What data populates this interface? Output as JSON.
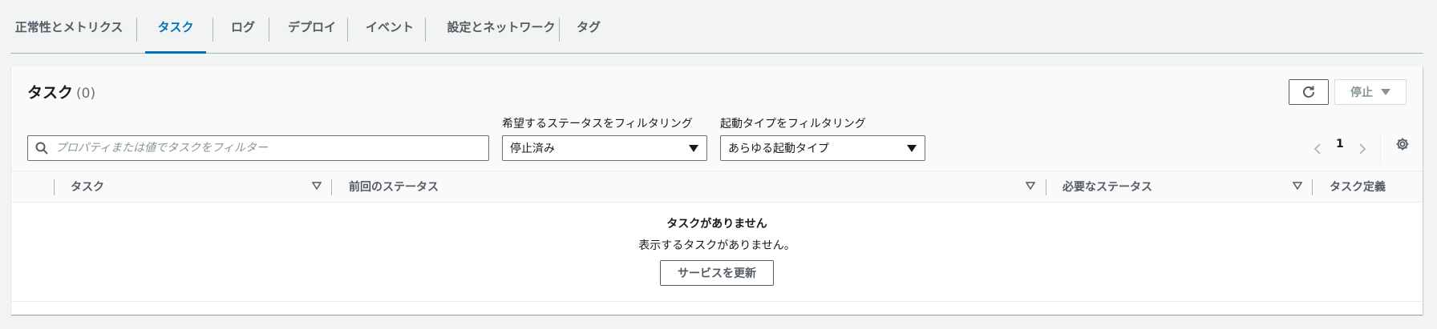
{
  "tabs": [
    {
      "label": "正常性とメトリクス",
      "active": false
    },
    {
      "label": "タスク",
      "active": true
    },
    {
      "label": "ログ",
      "active": false
    },
    {
      "label": "デプロイ",
      "active": false
    },
    {
      "label": "イベント",
      "active": false
    },
    {
      "label": "設定とネットワーク",
      "active": false
    },
    {
      "label": "タグ",
      "active": false
    }
  ],
  "panel": {
    "title": "タスク",
    "count": "(0)",
    "refresh_icon": "refresh-icon",
    "stop_label": "停止"
  },
  "search": {
    "placeholder": "プロパティまたは値でタスクをフィルター",
    "value": ""
  },
  "filters": {
    "desired_status": {
      "label": "希望するステータスをフィルタリング",
      "selected": "停止済み"
    },
    "launch_type": {
      "label": "起動タイプをフィルタリング",
      "selected": "あらゆる起動タイプ"
    }
  },
  "pagination": {
    "current_page": "1"
  },
  "table": {
    "columns": [
      "タスク",
      "前回のステータス",
      "必要なステータス",
      "タスク定義"
    ]
  },
  "empty_state": {
    "title": "タスクがありません",
    "description": "表示するタスクがありません。",
    "button_label": "サービスを更新"
  },
  "colors": {
    "accent": "#0073bb",
    "background": "#f2f3f3",
    "text": "#16191f",
    "muted": "#545b64"
  }
}
